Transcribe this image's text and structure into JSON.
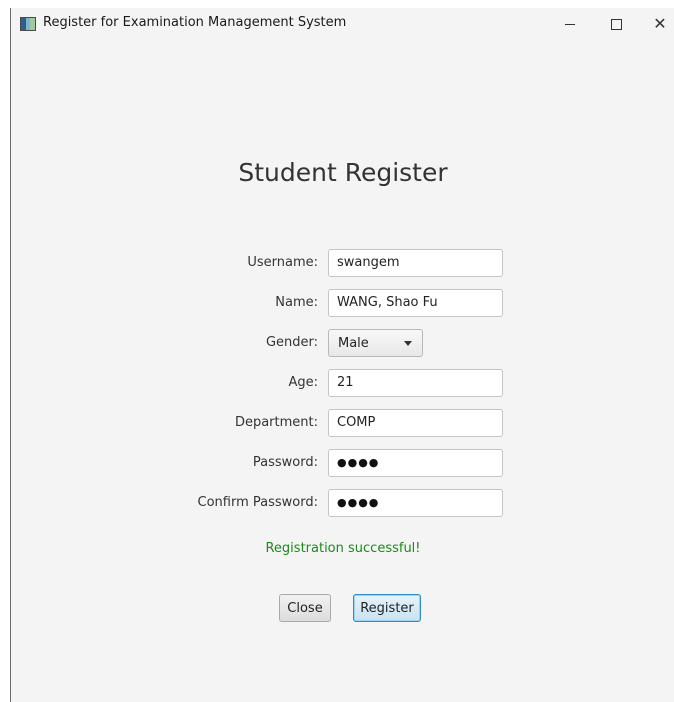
{
  "window": {
    "title": "Register for Examination Management System",
    "icon": "app-icon"
  },
  "heading": "Student Register",
  "form": {
    "username": {
      "label": "Username:",
      "value": "swangem"
    },
    "name": {
      "label": "Name:",
      "value": "WANG, Shao Fu"
    },
    "gender": {
      "label": "Gender:",
      "value": "Male"
    },
    "age": {
      "label": "Age:",
      "value": "21"
    },
    "department": {
      "label": "Department:",
      "value": "COMP"
    },
    "password": {
      "label": "Password:",
      "value": "●●●●"
    },
    "confirm_password": {
      "label": "Confirm Password:",
      "value": "●●●●"
    }
  },
  "status": {
    "message": "Registration successful!",
    "color": "#1a8a1a"
  },
  "buttons": {
    "close": "Close",
    "register": "Register"
  },
  "colors": {
    "background": "#f4f4f4",
    "accent": "#2f8dc8"
  }
}
